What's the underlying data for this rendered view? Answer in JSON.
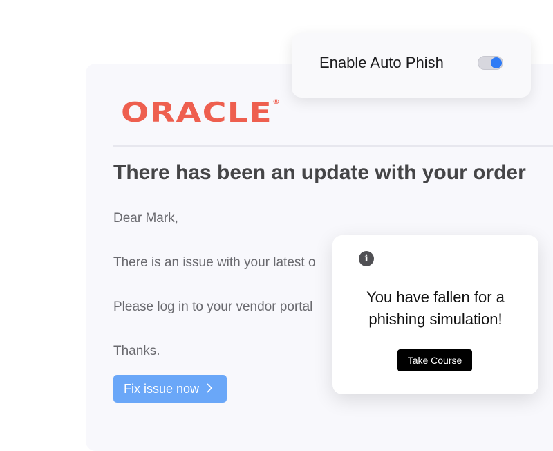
{
  "email": {
    "logo_text": "ORACLE",
    "logo_mark": "®",
    "title": "There has been an update with your order",
    "greeting": "Dear Mark,",
    "line1": "There is an issue with your latest o",
    "line2": "Please log in to your vendor portal",
    "signoff": "Thanks.",
    "cta_label": "Fix issue now",
    "cta_icon": "chevron-right-icon",
    "brand_color": "#ee5f4f",
    "cta_color": "#6aa7f8"
  },
  "auto_phish": {
    "label": "Enable Auto Phish",
    "enabled": true,
    "toggle_color": "#2f7bf5"
  },
  "popup": {
    "icon": "info-icon",
    "message_line1": "You have fallen for a",
    "message_line2": "phishing simulation!",
    "button_label": "Take Course"
  }
}
